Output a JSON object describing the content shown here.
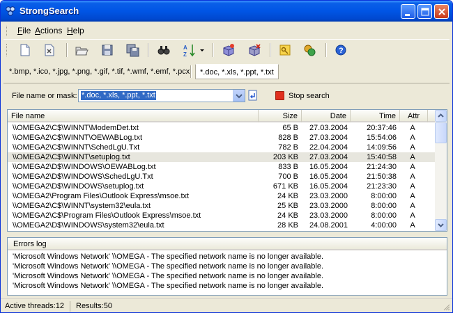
{
  "window": {
    "title": "StrongSearch",
    "title_color": "#0055e5"
  },
  "menu": {
    "items": [
      {
        "label": "File",
        "accel": "F",
        "rest": "ile"
      },
      {
        "label": "Actions",
        "accel": "A",
        "rest": "ctions"
      },
      {
        "label": "Help",
        "accel": "H",
        "rest": "elp"
      }
    ]
  },
  "toolbar": {
    "icons": [
      "new-icon",
      "delete-icon",
      "open-icon",
      "save-icon",
      "save-as-icon",
      "find-icon",
      "sort-icon",
      "sort-dropdown-icon",
      "add-icon",
      "remove-icon",
      "key-icon",
      "web-icon",
      "help-icon"
    ]
  },
  "masks": {
    "tabs": [
      {
        "label": "*.bmp, *.ico, *.jpg, *.png, *.gif, *.tif, *.wmf, *.emf, *.pcx",
        "active": false
      },
      {
        "label": "*.doc, *.xls, *.ppt, *.txt",
        "active": true
      }
    ]
  },
  "search": {
    "label": "File name or mask:",
    "value": "*.doc, *.xls, *.ppt, *.txt",
    "stop_label": "Stop search"
  },
  "results": {
    "columns": [
      "File name",
      "Size",
      "Date",
      "Time",
      "Attr"
    ],
    "rows": [
      {
        "name": "\\\\OMEGA2\\C$\\WINNT\\ModemDet.txt",
        "size": "65 B",
        "date": "27.03.2004",
        "time": "20:37:46",
        "attr": "A"
      },
      {
        "name": "\\\\OMEGA2\\C$\\WINNT\\OEWABLog.txt",
        "size": "828 B",
        "date": "27.03.2004",
        "time": "15:54:06",
        "attr": "A"
      },
      {
        "name": "\\\\OMEGA2\\C$\\WINNT\\SchedLgU.Txt",
        "size": "782 B",
        "date": "22.04.2004",
        "time": "14:09:56",
        "attr": "A"
      },
      {
        "name": "\\\\OMEGA2\\C$\\WINNT\\setuplog.txt",
        "size": "203 KB",
        "date": "27.03.2004",
        "time": "15:40:58",
        "attr": "A",
        "selected": true
      },
      {
        "name": "\\\\OMEGA2\\D$\\WINDOWS\\OEWABLog.txt",
        "size": "833 B",
        "date": "16.05.2004",
        "time": "21:24:30",
        "attr": "A"
      },
      {
        "name": "\\\\OMEGA2\\D$\\WINDOWS\\SchedLgU.Txt",
        "size": "700 B",
        "date": "16.05.2004",
        "time": "21:50:38",
        "attr": "A"
      },
      {
        "name": "\\\\OMEGA2\\D$\\WINDOWS\\setuplog.txt",
        "size": "671 KB",
        "date": "16.05.2004",
        "time": "21:23:30",
        "attr": "A"
      },
      {
        "name": "\\\\OMEGA2\\Program Files\\Outlook Express\\msoe.txt",
        "size": "24 KB",
        "date": "23.03.2000",
        "time": "8:00:00",
        "attr": "A"
      },
      {
        "name": "\\\\OMEGA2\\C$\\WINNT\\system32\\eula.txt",
        "size": "25 KB",
        "date": "23.03.2000",
        "time": "8:00:00",
        "attr": "A"
      },
      {
        "name": "\\\\OMEGA2\\C$\\Program Files\\Outlook Express\\msoe.txt",
        "size": "24 KB",
        "date": "23.03.2000",
        "time": "8:00:00",
        "attr": "A"
      },
      {
        "name": "\\\\OMEGA2\\D$\\WINDOWS\\system32\\eula.txt",
        "size": "28 KB",
        "date": "24.08.2001",
        "time": "4:00:00",
        "attr": "A"
      }
    ]
  },
  "errors": {
    "header": "Errors log",
    "lines": [
      "'Microsoft Windows Network' \\\\OMEGA - The specified network name is no longer available.",
      "'Microsoft Windows Network' \\\\OMEGA - The specified network name is no longer available.",
      "'Microsoft Windows Network' \\\\OMEGA - The specified network name is no longer available.",
      "'Microsoft Windows Network' \\\\OMEGA - The specified network name is no longer available."
    ]
  },
  "status": {
    "threads": "Active threads:12",
    "results": "Results:50"
  }
}
